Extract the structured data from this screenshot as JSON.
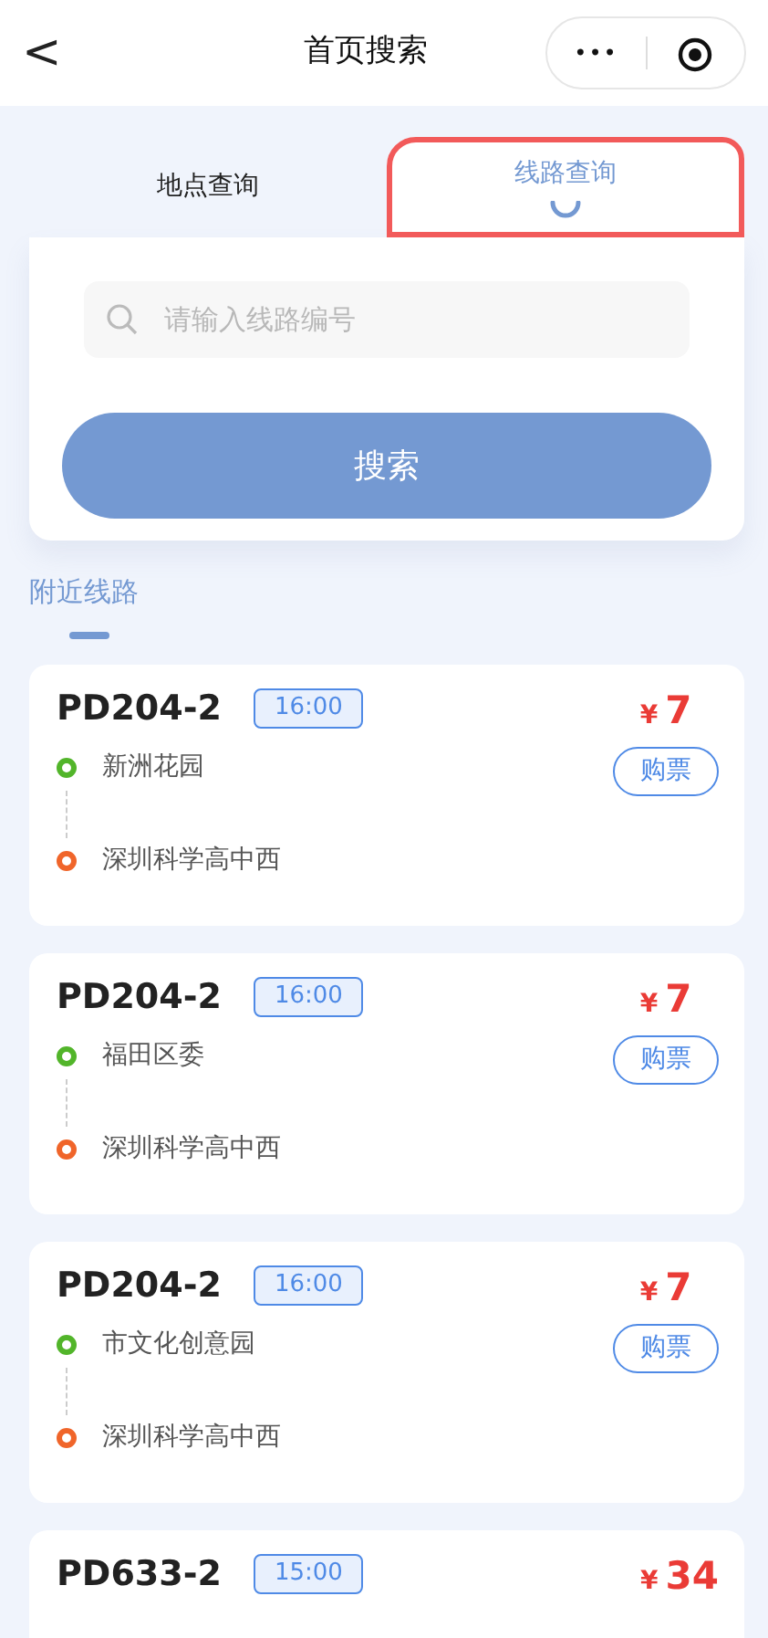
{
  "nav": {
    "back": "<",
    "title": "首页搜索",
    "more": "•••"
  },
  "tabs": [
    {
      "label": "地点查询",
      "selected": false,
      "highlighted": false
    },
    {
      "label": "线路查询",
      "selected": true,
      "highlighted": true
    }
  ],
  "search": {
    "placeholder": "请输入线路编号",
    "button": "搜索"
  },
  "section": {
    "title": "附近线路"
  },
  "routes": [
    {
      "code": "PD204-2",
      "time": "16:00",
      "currency": "¥",
      "price": "7",
      "buy": "购票",
      "stops": [
        {
          "name": "新洲花园",
          "color": "#52b52a"
        },
        {
          "name": "深圳科学高中西",
          "color": "#f0652a"
        }
      ]
    },
    {
      "code": "PD204-2",
      "time": "16:00",
      "currency": "¥",
      "price": "7",
      "buy": "购票",
      "stops": [
        {
          "name": "福田区委",
          "color": "#52b52a"
        },
        {
          "name": "深圳科学高中西",
          "color": "#f0652a"
        }
      ]
    },
    {
      "code": "PD204-2",
      "time": "16:00",
      "currency": "¥",
      "price": "7",
      "buy": "购票",
      "stops": [
        {
          "name": "市文化创意园",
          "color": "#52b52a"
        },
        {
          "name": "深圳科学高中西",
          "color": "#f0652a"
        }
      ]
    },
    {
      "code": "PD633-2",
      "time": "15:00",
      "currency": "¥",
      "price": "34"
    }
  ]
}
